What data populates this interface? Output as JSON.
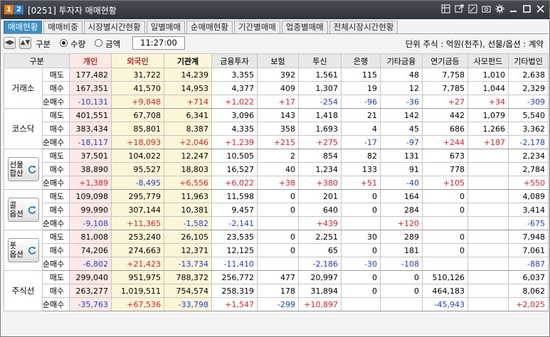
{
  "titlebar": {
    "badge1": "1",
    "badge2": "2",
    "title": "[0251] 투자자 매매현황"
  },
  "tabs": [
    "매매현황",
    "매매비중",
    "시장별시간현황",
    "일별매매",
    "순매매현황",
    "기간별매매",
    "업종별매매",
    "전체시장시간현황"
  ],
  "toolbar": {
    "group_label": "구분",
    "option_qty": "수량",
    "option_amt": "금액",
    "time": "11:27:00",
    "unit_text": "단위 주식 : 억원(천주), 선물/옵션 : 계약"
  },
  "columns": [
    "구분",
    "개인",
    "외국인",
    "기관계",
    "금융투자",
    "보험",
    "투신",
    "은행",
    "기타금융",
    "연기금등",
    "사모펀드",
    "기타법인"
  ],
  "groups": [
    {
      "name": "거래소",
      "rows": [
        {
          "label": "매도",
          "values": [
            "177,482",
            "31,722",
            "14,239",
            "3,355",
            "392",
            "1,561",
            "115",
            "48",
            "7,758",
            "1,010",
            "2,638"
          ]
        },
        {
          "label": "매수",
          "values": [
            "167,351",
            "41,570",
            "14,953",
            "4,377",
            "409",
            "1,307",
            "19",
            "12",
            "7,785",
            "1,044",
            "2,329"
          ]
        },
        {
          "label": "순매수",
          "values": [
            "-10,131",
            "+9,848",
            "+714",
            "+1,022",
            "+17",
            "-254",
            "-96",
            "-36",
            "+27",
            "+34",
            "-309"
          ]
        }
      ]
    },
    {
      "name": "코스닥",
      "rows": [
        {
          "label": "매도",
          "values": [
            "401,551",
            "67,708",
            "6,341",
            "3,096",
            "143",
            "1,418",
            "21",
            "142",
            "442",
            "1,079",
            "5,540"
          ]
        },
        {
          "label": "매수",
          "values": [
            "383,434",
            "85,801",
            "8,387",
            "4,335",
            "358",
            "1,693",
            "4",
            "45",
            "686",
            "1,266",
            "3,362"
          ]
        },
        {
          "label": "순매수",
          "values": [
            "-18,117",
            "+18,093",
            "+2,046",
            "+1,239",
            "+215",
            "+275",
            "-17",
            "-97",
            "+244",
            "+187",
            "-2,178"
          ]
        }
      ]
    },
    {
      "name": "선물\n합산",
      "button": true,
      "rows": [
        {
          "label": "매도",
          "values": [
            "37,501",
            "104,022",
            "12,247",
            "10,505",
            "2",
            "854",
            "82",
            "131",
            "673",
            "",
            "2,234"
          ]
        },
        {
          "label": "매수",
          "values": [
            "38,890",
            "95,527",
            "18,803",
            "16,527",
            "40",
            "1,234",
            "133",
            "91",
            "778",
            "",
            "2,784"
          ]
        },
        {
          "label": "순매수",
          "values": [
            "+1,389",
            "-8,495",
            "+6,556",
            "+6,022",
            "+38",
            "+380",
            "+51",
            "-40",
            "+105",
            "",
            "+550"
          ]
        }
      ]
    },
    {
      "name": "콜\n옵션",
      "button": true,
      "rows": [
        {
          "label": "매도",
          "values": [
            "109,098",
            "295,779",
            "11,963",
            "11,598",
            "0",
            "201",
            "0",
            "164",
            "0",
            "",
            "4,089"
          ]
        },
        {
          "label": "매수",
          "values": [
            "99,990",
            "307,144",
            "10,381",
            "9,457",
            "0",
            "640",
            "0",
            "284",
            "0",
            "",
            "3,414"
          ]
        },
        {
          "label": "순매수",
          "values": [
            "-9,108",
            "+11,365",
            "-1,582",
            "-2,141",
            "",
            "+439",
            "",
            "+120",
            "",
            "",
            "-675"
          ]
        }
      ]
    },
    {
      "name": "풋\n옵션",
      "button": true,
      "rows": [
        {
          "label": "매도",
          "values": [
            "81,008",
            "253,240",
            "26,105",
            "23,535",
            "0",
            "2,251",
            "30",
            "289",
            "0",
            "",
            "7,948"
          ]
        },
        {
          "label": "매수",
          "values": [
            "74,206",
            "274,663",
            "12,371",
            "12,125",
            "0",
            "65",
            "0",
            "181",
            "0",
            "",
            "7,061"
          ]
        },
        {
          "label": "순매수",
          "values": [
            "-6,802",
            "+21,423",
            "-13,734",
            "-11,410",
            "",
            "-2,186",
            "-30",
            "-108",
            "",
            "",
            "-887"
          ]
        }
      ]
    },
    {
      "name": "주식선",
      "rows": [
        {
          "label": "매도",
          "values": [
            "299,040",
            "951,975",
            "788,372",
            "256,772",
            "477",
            "20,997",
            "0",
            "0",
            "510,126",
            "",
            "6,037"
          ]
        },
        {
          "label": "매수",
          "values": [
            "263,277",
            "1,019,511",
            "754,574",
            "258,319",
            "178",
            "31,894",
            "0",
            "0",
            "464,183",
            "",
            "8,062"
          ]
        },
        {
          "label": "순매수",
          "values": [
            "-35,763",
            "+67,536",
            "-33,798",
            "+1,547",
            "-299",
            "+10,897",
            "",
            "",
            "-45,943",
            "",
            "+2,025"
          ]
        }
      ]
    }
  ],
  "colors": {
    "positive": "#e0232a",
    "negative": "#2040d8",
    "active_tab": "#3a8fc7"
  }
}
